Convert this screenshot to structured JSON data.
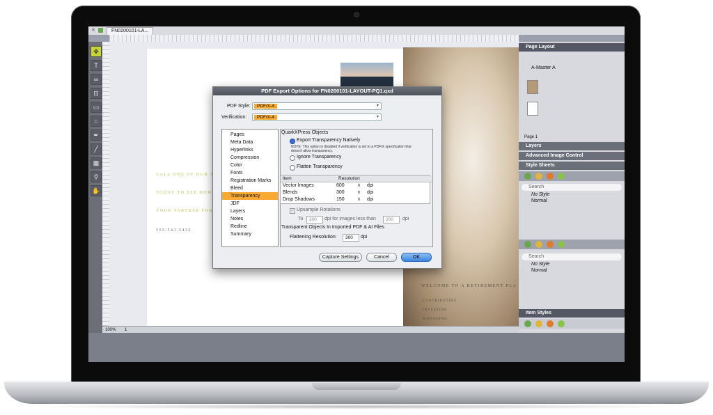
{
  "app": {
    "doc_tab": "FN0200101-LA..."
  },
  "canvas": {
    "side_lines": [
      "CALL ONE OF OUR A",
      "TODAY TO SEE HOW",
      "YOUR PARTNER FOR",
      "555.543.5432"
    ],
    "welcome": "WELCOME TO A RETIREMENT PLA",
    "bullets": [
      "CONTRIBUTING",
      "INVESTING",
      "MANAGING"
    ]
  },
  "statusbar": {
    "zoom": "100%",
    "page": "1"
  },
  "dialog": {
    "title": "PDF Export Options for FN0200101-LAYOUT-PQ1.qxd",
    "pdf_style_label": "PDF Style:",
    "pdf_style_value": "PDF/X-4",
    "verification_label": "Verification:",
    "verification_value": "PDF/X-4",
    "categories": [
      "Pages",
      "Meta Data",
      "Hyperlinks",
      "Compression",
      "Color",
      "Fonts",
      "Registration Marks",
      "Bleed",
      "Transparency",
      "JDF",
      "Layers",
      "Notes",
      "Redline",
      "Summary"
    ],
    "selected_category": "Transparency",
    "group_title": "QuarkXPress Objects",
    "radio_native": "Export Transparency Natively",
    "note": "NOTE: This option is disabled if verification is set to a PDF/X specification that doesn't allow transparency.",
    "radio_ignore": "Ignore Transparency",
    "radio_flatten": "Flatten Transparency",
    "table_headers": [
      "Item",
      "Resolution"
    ],
    "table_rows": [
      {
        "item": "Vector Images",
        "res": "600",
        "unit": "dpi"
      },
      {
        "item": "Blends",
        "res": "300",
        "unit": "dpi"
      },
      {
        "item": "Drop Shadows",
        "res": "150",
        "unit": "dpi"
      }
    ],
    "upsample_label": "Upsample Rotations",
    "to_label": "To",
    "to_value": "300",
    "dpi_less_label": "dpi for images less than",
    "less_value": "200",
    "dpi": "dpi",
    "imported_title": "Transparent Objects In Imported PDF & AI Files",
    "flattening_label": "Flattening Resolution:",
    "flattening_value": "300",
    "capture_button": "Capture Settings",
    "cancel_button": "Cancel",
    "ok_button": "OK"
  },
  "panels": {
    "page_layout": "Page Layout",
    "master_a": "A-Master A",
    "page_label": "Page 1",
    "layers": "Layers",
    "advanced_image_control": "Advanced Image Control",
    "style_sheets": "Style Sheets",
    "search": "Search",
    "para_styles": [
      "No Style",
      "Normal"
    ],
    "char_styles": [
      "No Style",
      "Normal"
    ],
    "item_styles": "Item Styles",
    "accent_color": "#f7a931"
  }
}
